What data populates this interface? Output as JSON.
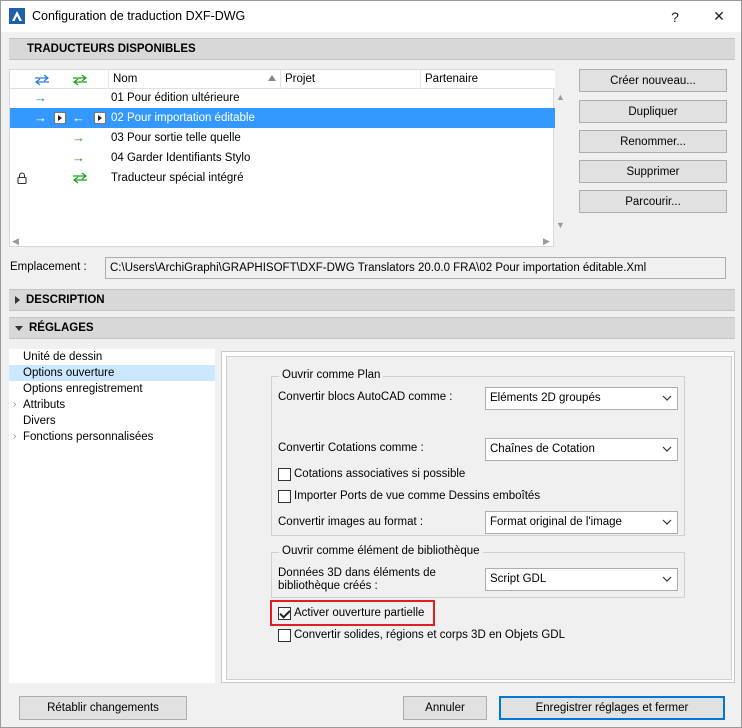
{
  "window": {
    "title": "Configuration de traduction DXF-DWG",
    "help": "?",
    "close": "✕"
  },
  "translators": {
    "header": "TRADUCTEURS DISPONIBLES",
    "columns": {
      "name": "Nom",
      "project": "Projet",
      "partner": "Partenaire"
    },
    "rows": [
      {
        "name": "01 Pour édition ultérieure"
      },
      {
        "name": "02 Pour importation éditable"
      },
      {
        "name": "03 Pour sortie telle quelle"
      },
      {
        "name": "04 Garder Identifiants Stylo"
      },
      {
        "name": "Traducteur spécial intégré"
      }
    ],
    "buttons": {
      "create": "Créer nouveau...",
      "duplicate": "Dupliquer",
      "rename": "Renommer...",
      "delete": "Supprimer",
      "browse": "Parcourir..."
    },
    "location_label": "Emplacement :",
    "location_value": "C:\\Users\\ArchiGraphi\\GRAPHISOFT\\DXF-DWG Translators 20.0.0 FRA\\02 Pour importation éditable.Xml"
  },
  "description": {
    "header": "DESCRIPTION"
  },
  "settings": {
    "header": "RÉGLAGES",
    "tree": [
      {
        "label": "Unité de dessin"
      },
      {
        "label": "Options ouverture"
      },
      {
        "label": "Options enregistrement"
      },
      {
        "label": "Attributs"
      },
      {
        "label": "Divers"
      },
      {
        "label": "Fonctions personnalisées"
      }
    ],
    "open_as_plan": {
      "title": "Ouvrir comme Plan",
      "blocks_label": "Convertir blocs AutoCAD comme :",
      "blocks_value": "Eléments 2D groupés",
      "dims_label": "Convertir Cotations comme :",
      "dims_value": "Chaînes de Cotation",
      "assoc_dims": "Cotations associatives si possible",
      "import_ports": "Importer Ports de vue comme Dessins emboîtés",
      "images_label": "Convertir images au format :",
      "images_value": "Format original de l'image"
    },
    "open_as_library": {
      "title": "Ouvrir comme élément de bibliothèque",
      "data3d_label_1": "Données 3D dans éléments de",
      "data3d_label_2": "bibliothèque créés :",
      "data3d_value": "Script GDL"
    },
    "partial_open": "Activer ouverture partielle",
    "convert_solids": "Convertir solides, régions et corps 3D en Objets GDL"
  },
  "footer": {
    "reset": "Rétablir changements",
    "cancel": "Annuler",
    "save": "Enregistrer réglages et fermer"
  }
}
